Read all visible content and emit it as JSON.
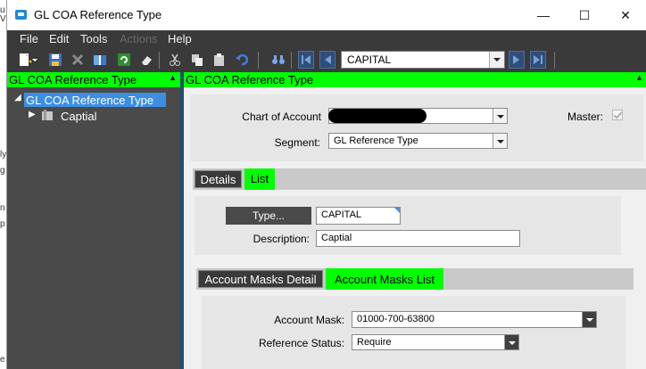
{
  "window": {
    "title": "GL COA Reference Type"
  },
  "menu": [
    {
      "label": "File",
      "enabled": true
    },
    {
      "label": "Edit",
      "enabled": true
    },
    {
      "label": "Tools",
      "enabled": true
    },
    {
      "label": "Actions",
      "enabled": false
    },
    {
      "label": "Help",
      "enabled": true
    }
  ],
  "toolbar": {
    "record_value": "CAPITAL"
  },
  "tree": {
    "header": "GL COA Reference Type",
    "root_label": "GL COA Reference Type",
    "child_label": "Captial"
  },
  "main": {
    "header": "GL COA Reference Type",
    "chart_of_account_label": "Chart of Account",
    "chart_of_account_value": "",
    "segment_label": "Segment:",
    "segment_value": "GL Reference Type",
    "master_label": "Master:",
    "master_checked": true
  },
  "tabs": [
    {
      "label": "Details"
    },
    {
      "label": "List"
    }
  ],
  "details": {
    "type_button": "Type...",
    "type_value": "CAPITAL",
    "description_label": "Description:",
    "description_value": "Captial"
  },
  "subtabs": [
    {
      "label": "Account Masks Detail"
    },
    {
      "label": "Account Masks List"
    }
  ],
  "masks": {
    "account_mask_label": "Account Mask:",
    "account_mask_value": "01000-700-63800",
    "reference_status_label": "Reference Status:",
    "reference_status_value": "Require"
  },
  "colors": {
    "highlight_green": "#00ff00",
    "dark_chrome": "#3a3a3a",
    "selection_blue": "#3d8ee0"
  }
}
